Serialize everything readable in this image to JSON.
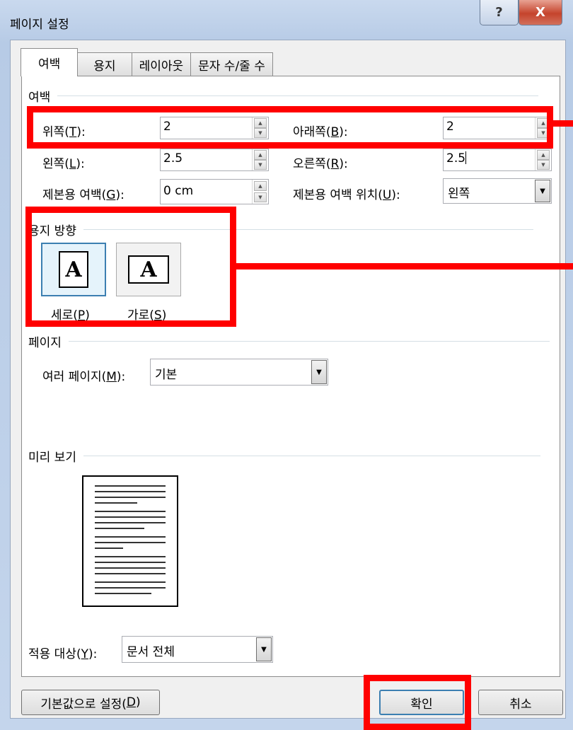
{
  "window": {
    "title": "페이지 설정",
    "help": "?",
    "close": "X"
  },
  "tabs": [
    {
      "label": "여백",
      "active": true
    },
    {
      "label": "용지",
      "active": false
    },
    {
      "label": "레이아웃",
      "active": false
    },
    {
      "label": "문자 수/줄 수",
      "active": false
    }
  ],
  "margins": {
    "group": "여백",
    "top_label": "위쪽(",
    "top_key": "T",
    "top_end": "):",
    "top_value": "2",
    "bottom_label": "아래쪽(",
    "bottom_key": "B",
    "bottom_end": "):",
    "bottom_value": "2",
    "left_label": "왼쪽(",
    "left_key": "L",
    "left_end": "):",
    "left_value": "2.5",
    "right_label": "오른쪽(",
    "right_key": "R",
    "right_end": "):",
    "right_value": "2.5",
    "gutter_label": "제본용 여백(",
    "gutter_key": "G",
    "gutter_end": "):",
    "gutter_value": "0 cm",
    "gutter_pos_label": "제본용 여백 위치(",
    "gutter_pos_key": "U",
    "gutter_pos_end": "):",
    "gutter_pos_value": "왼쪽"
  },
  "orientation": {
    "group": "용지 방향",
    "portrait_label": "세로(",
    "portrait_key": "P",
    "portrait_end": ")",
    "landscape_label": "가로(",
    "landscape_key": "S",
    "landscape_end": ")",
    "glyph": "A",
    "selected": "portrait"
  },
  "pages": {
    "group": "페이지",
    "multiple_label": "여러 페이지(",
    "multiple_key": "M",
    "multiple_end": "):",
    "multiple_value": "기본"
  },
  "preview": {
    "group": "미리 보기"
  },
  "apply": {
    "label": "적용 대상(",
    "key": "Y",
    "end": "):",
    "value": "문서 전체"
  },
  "buttons": {
    "default": "기본값으로 설정(",
    "default_key": "D",
    "default_end": ")",
    "ok": "확인",
    "cancel": "취소"
  },
  "colors": {
    "highlight": "#ff0000",
    "selection": "#3c7fb1"
  }
}
